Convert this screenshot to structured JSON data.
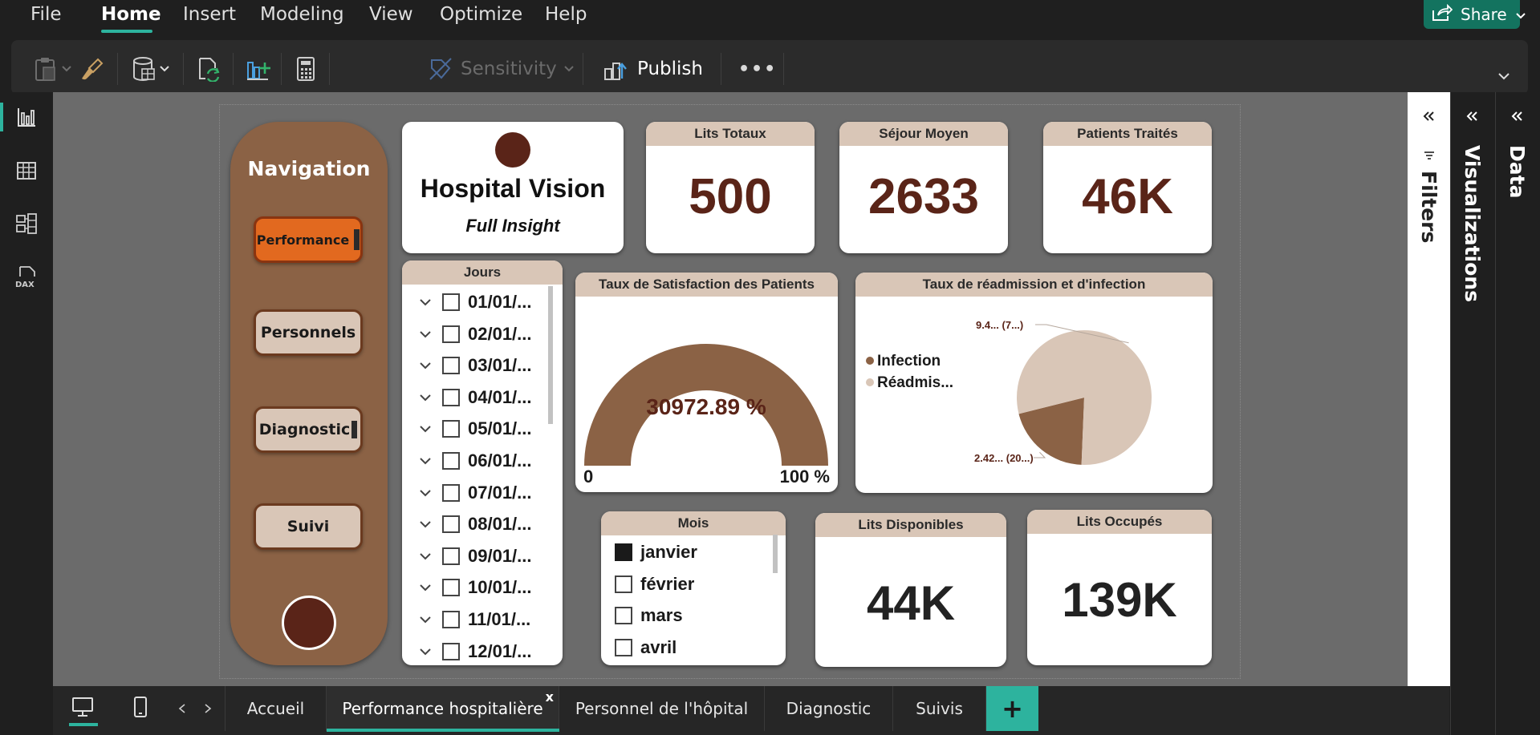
{
  "menu": {
    "items": [
      "File",
      "Home",
      "Insert",
      "Modeling",
      "View",
      "Optimize",
      "Help"
    ],
    "share_label": "Share"
  },
  "ribbon": {
    "sensitivity_label": "Sensitivity",
    "publish_label": "Publish",
    "more_label": "•••"
  },
  "nav": {
    "title": "Navigation",
    "buttons": [
      "Performance",
      "Personnels",
      "Diagnostic",
      "Suivi"
    ]
  },
  "header_card": {
    "title": "Hospital Vision",
    "subtitle": "Full Insight"
  },
  "kpis": {
    "lits_totaux": {
      "label": "Lits Totaux",
      "value": "500"
    },
    "sejour_moyen": {
      "label": "Séjour Moyen",
      "value": "2633"
    },
    "patients_traites": {
      "label": "Patients Traités",
      "value": "46K"
    },
    "lits_disponibles": {
      "label": "Lits Disponibles",
      "value": "44K"
    },
    "lits_occupes": {
      "label": "Lits Occupés",
      "value": "139K"
    }
  },
  "jours_slicer": {
    "title": "Jours",
    "items": [
      "01/01/...",
      "02/01/...",
      "03/01/...",
      "04/01/...",
      "05/01/...",
      "06/01/...",
      "07/01/...",
      "08/01/...",
      "09/01/...",
      "10/01/...",
      "11/01/...",
      "12/01/..."
    ]
  },
  "mois_slicer": {
    "title": "Mois",
    "items": [
      "janvier",
      "février",
      "mars",
      "avril"
    ],
    "checked": "janvier"
  },
  "gauge": {
    "title": "Taux de Satisfaction des Patients",
    "value_text": "30972.89 %",
    "min_label": "0",
    "max_label": "100 %",
    "fill_color": "#8b6245"
  },
  "chart_data": {
    "type": "pie",
    "title": "Taux de réadmission et d'infection",
    "categories": [
      "Infection",
      "Réadmis..."
    ],
    "values": [
      2.42,
      9.4
    ],
    "data_labels": [
      "2.42... (20...)",
      "9.4... (7...)"
    ],
    "colors": [
      "#8b6245",
      "#d9c6b7"
    ],
    "legend_position": "left"
  },
  "pages": {
    "tabs": [
      "Accueil",
      "Performance hospitalière",
      "Personnel de l'hôpital",
      "Diagnostic",
      "Suivis"
    ],
    "active": "Performance hospitalière",
    "close_label": "x",
    "add_label": "+"
  },
  "panes": {
    "filters": "Filters",
    "visualizations": "Visualizations",
    "data": "Data"
  },
  "colors": {
    "accent": "#2db39e",
    "brown": "#8b6245",
    "dark_brown": "#5a2418",
    "tan": "#d9c6b7",
    "orange": "#e2691f"
  }
}
